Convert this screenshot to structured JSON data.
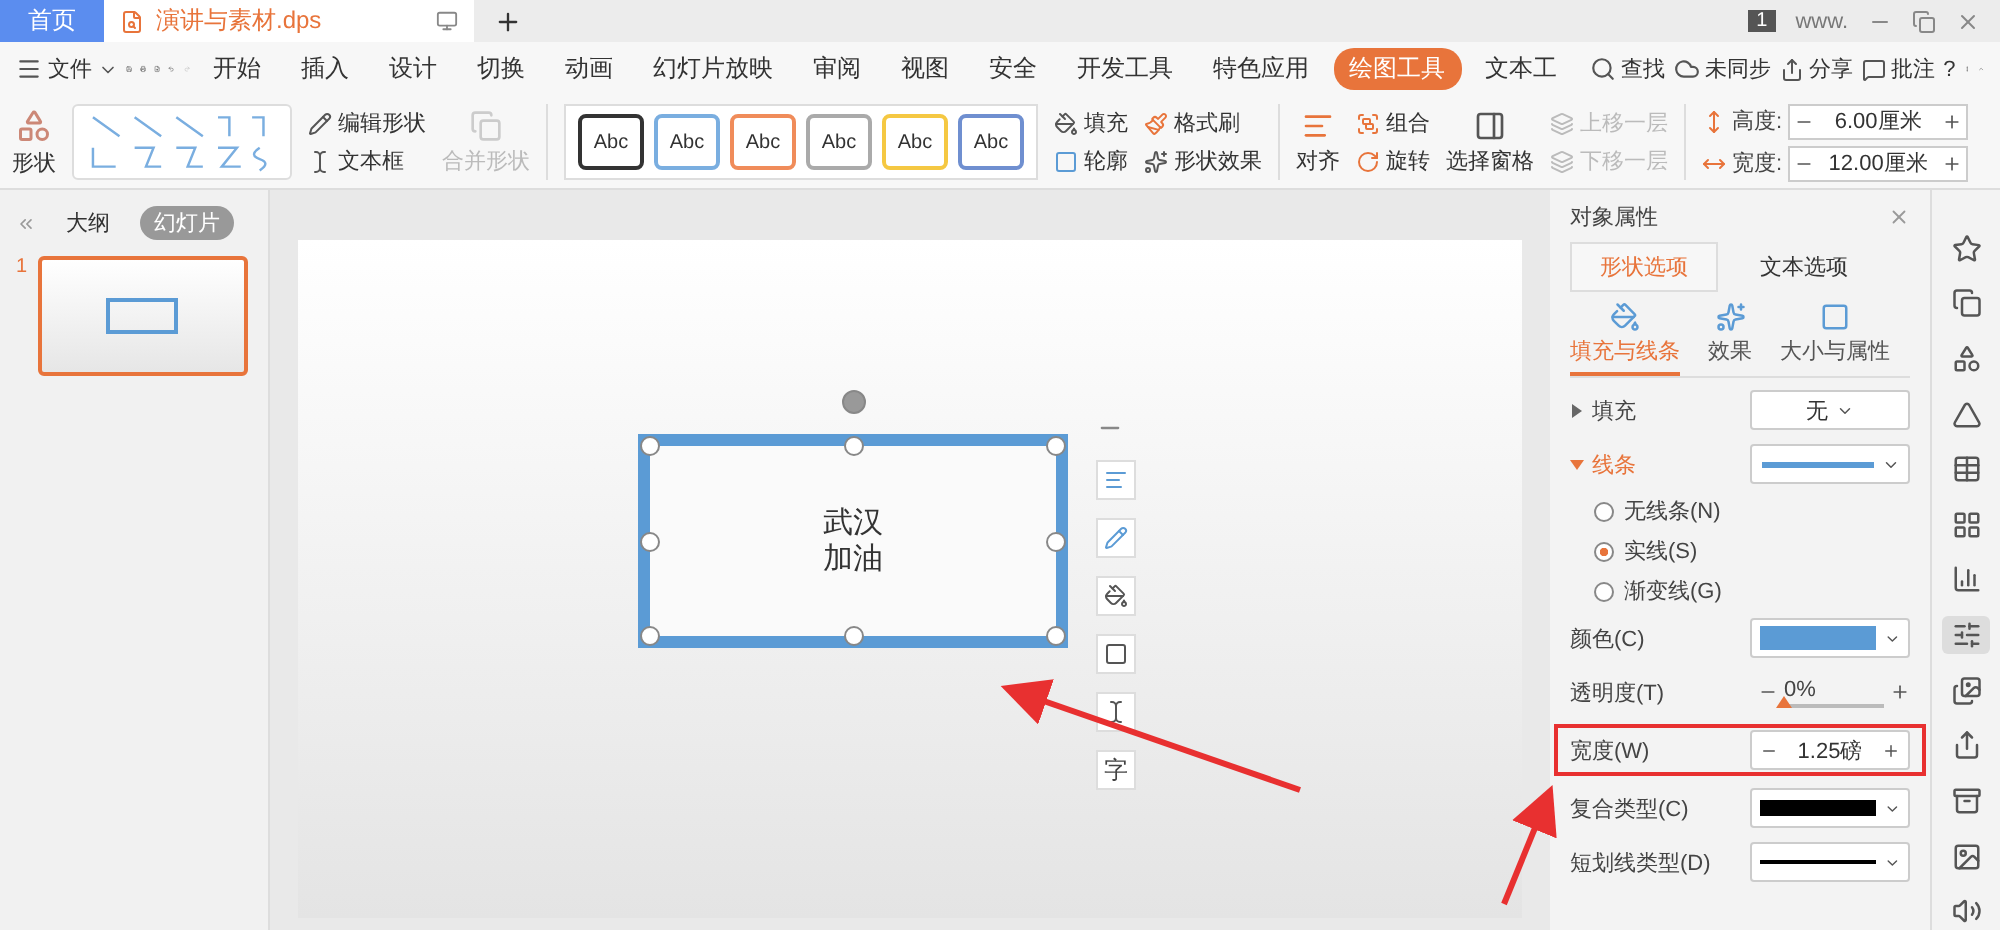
{
  "title_bar": {
    "home_tab": "首页",
    "document_tab": "演讲与素材.dps",
    "badge": "1",
    "user_name": "www."
  },
  "menu": {
    "file": "文件",
    "tabs": [
      {
        "label": "开始",
        "selected": false
      },
      {
        "label": "插入",
        "selected": false
      },
      {
        "label": "设计",
        "selected": false
      },
      {
        "label": "切换",
        "selected": false
      },
      {
        "label": "动画",
        "selected": false
      },
      {
        "label": "幻灯片放映",
        "selected": false
      },
      {
        "label": "审阅",
        "selected": false
      },
      {
        "label": "视图",
        "selected": false
      },
      {
        "label": "安全",
        "selected": false
      },
      {
        "label": "开发工具",
        "selected": false
      },
      {
        "label": "特色应用",
        "selected": false
      },
      {
        "label": "绘图工具",
        "selected": true
      },
      {
        "label": "文本工",
        "selected": false
      }
    ],
    "search": "查找",
    "sync": "未同步",
    "share": "分享",
    "comment": "批注",
    "help": "?"
  },
  "ribbon": {
    "shape": "形状",
    "edit_shape": "编辑形状",
    "text_box": "文本框",
    "merge_shape": {
      "label": "合并形状",
      "disabled": true
    },
    "styles": [
      {
        "label": "Abc",
        "color": "#333333"
      },
      {
        "label": "Abc",
        "color": "#7aaee0"
      },
      {
        "label": "Abc",
        "color": "#f08c5a"
      },
      {
        "label": "Abc",
        "color": "#aaaaaa"
      },
      {
        "label": "Abc",
        "color": "#f5c842"
      },
      {
        "label": "Abc",
        "color": "#6f8fd0"
      }
    ],
    "fill": "填充",
    "format_painter": "格式刷",
    "outline": "轮廓",
    "shape_effect": "形状效果",
    "align": "对齐",
    "group": "组合",
    "rotate": "旋转",
    "selection_pane": "选择窗格",
    "bring_forward": {
      "label": "上移一层",
      "disabled": true
    },
    "send_backward": {
      "label": "下移一层",
      "disabled": true
    },
    "height": {
      "label": "高度:",
      "value": "6.00厘米"
    },
    "width": {
      "label": "宽度:",
      "value": "12.00厘米"
    }
  },
  "left_panel": {
    "tabs": [
      {
        "label": "大纲",
        "selected": false
      },
      {
        "label": "幻灯片",
        "selected": true
      }
    ],
    "slides": [
      {
        "number": "1",
        "selected": true
      }
    ]
  },
  "slide": {
    "lines": [
      "武汉",
      "加油"
    ],
    "quick_tool_glyph": "字"
  },
  "properties": {
    "title": "对象属性",
    "tabs": [
      {
        "label": "形状选项",
        "selected": true
      },
      {
        "label": "文本选项",
        "selected": false
      }
    ],
    "subtabs": [
      {
        "label": "填充与线条",
        "selected": true
      },
      {
        "label": "效果",
        "selected": false
      },
      {
        "label": "大小与属性",
        "selected": false
      }
    ],
    "fill": {
      "label": "填充",
      "expanded": false,
      "value": "无"
    },
    "line": {
      "label": "线条",
      "expanded": true
    },
    "line_types": [
      {
        "label": "无线条(N)",
        "selected": false
      },
      {
        "label": "实线(S)",
        "selected": true
      },
      {
        "label": "渐变线(G)",
        "selected": false
      }
    ],
    "color": {
      "label": "颜色(C)"
    },
    "transparency": {
      "label": "透明度(T)",
      "reading": "0%",
      "level": 0
    },
    "width": {
      "label": "宽度(W)",
      "value": "1.25磅"
    },
    "compound": {
      "label": "复合类型(C)"
    },
    "dash": {
      "label": "短划线类型(D)"
    }
  }
}
